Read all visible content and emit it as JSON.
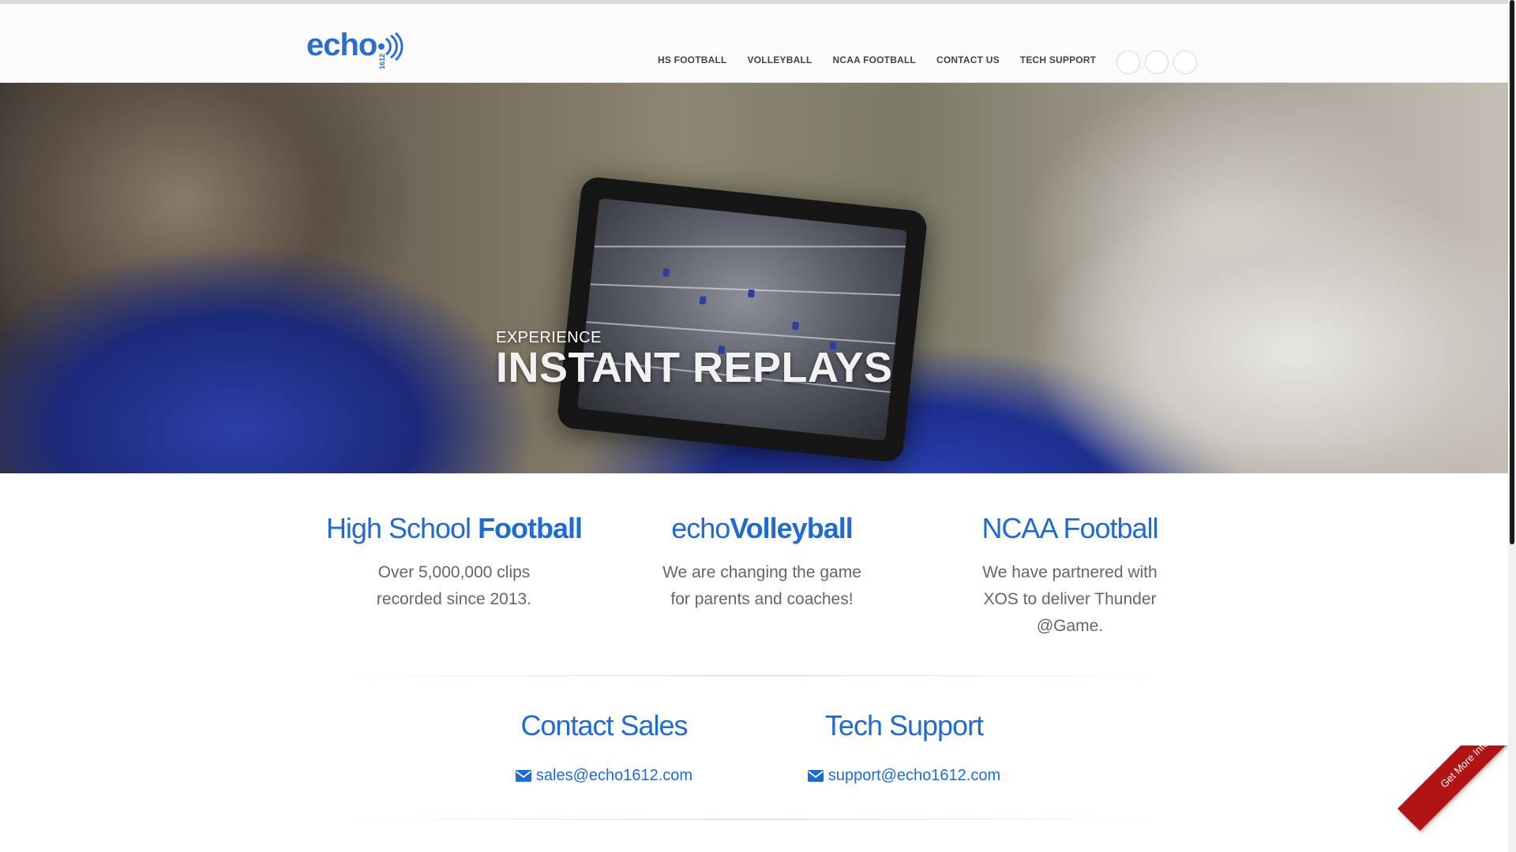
{
  "brand": {
    "logo_text": "echo",
    "logo_sub": "1612",
    "accent_color": "#1f6bd0",
    "ribbon_color": "#b01414"
  },
  "nav": {
    "items": [
      {
        "label": "HS FOOTBALL"
      },
      {
        "label": "VOLLEYBALL"
      },
      {
        "label": "NCAA FOOTBALL"
      },
      {
        "label": "CONTACT US"
      },
      {
        "label": "TECH SUPPORT"
      }
    ],
    "social_icons": [
      "social-icon-1",
      "social-icon-2",
      "social-icon-3"
    ]
  },
  "hero": {
    "kicker": "EXPERIENCE",
    "headline": "INSTANT REPLAYS"
  },
  "features": [
    {
      "title_light": "High School ",
      "title_bold": "Football",
      "description": "Over 5,000,000 clips recorded since 2013."
    },
    {
      "title_light": "echo",
      "title_bold": "Volleyball",
      "description": "We are changing the game for parents and coaches!"
    },
    {
      "title_light": "NCAA Football",
      "title_bold": "",
      "description": "We have partnered with XOS to deliver Thunder @Game."
    }
  ],
  "contacts": [
    {
      "title": "Contact Sales",
      "email": "sales@echo1612.com",
      "icon": "envelope-icon"
    },
    {
      "title": "Tech Support",
      "email": "support@echo1612.com",
      "icon": "envelope-icon"
    }
  ],
  "corner_ribbon": {
    "label": "Get More Info"
  }
}
